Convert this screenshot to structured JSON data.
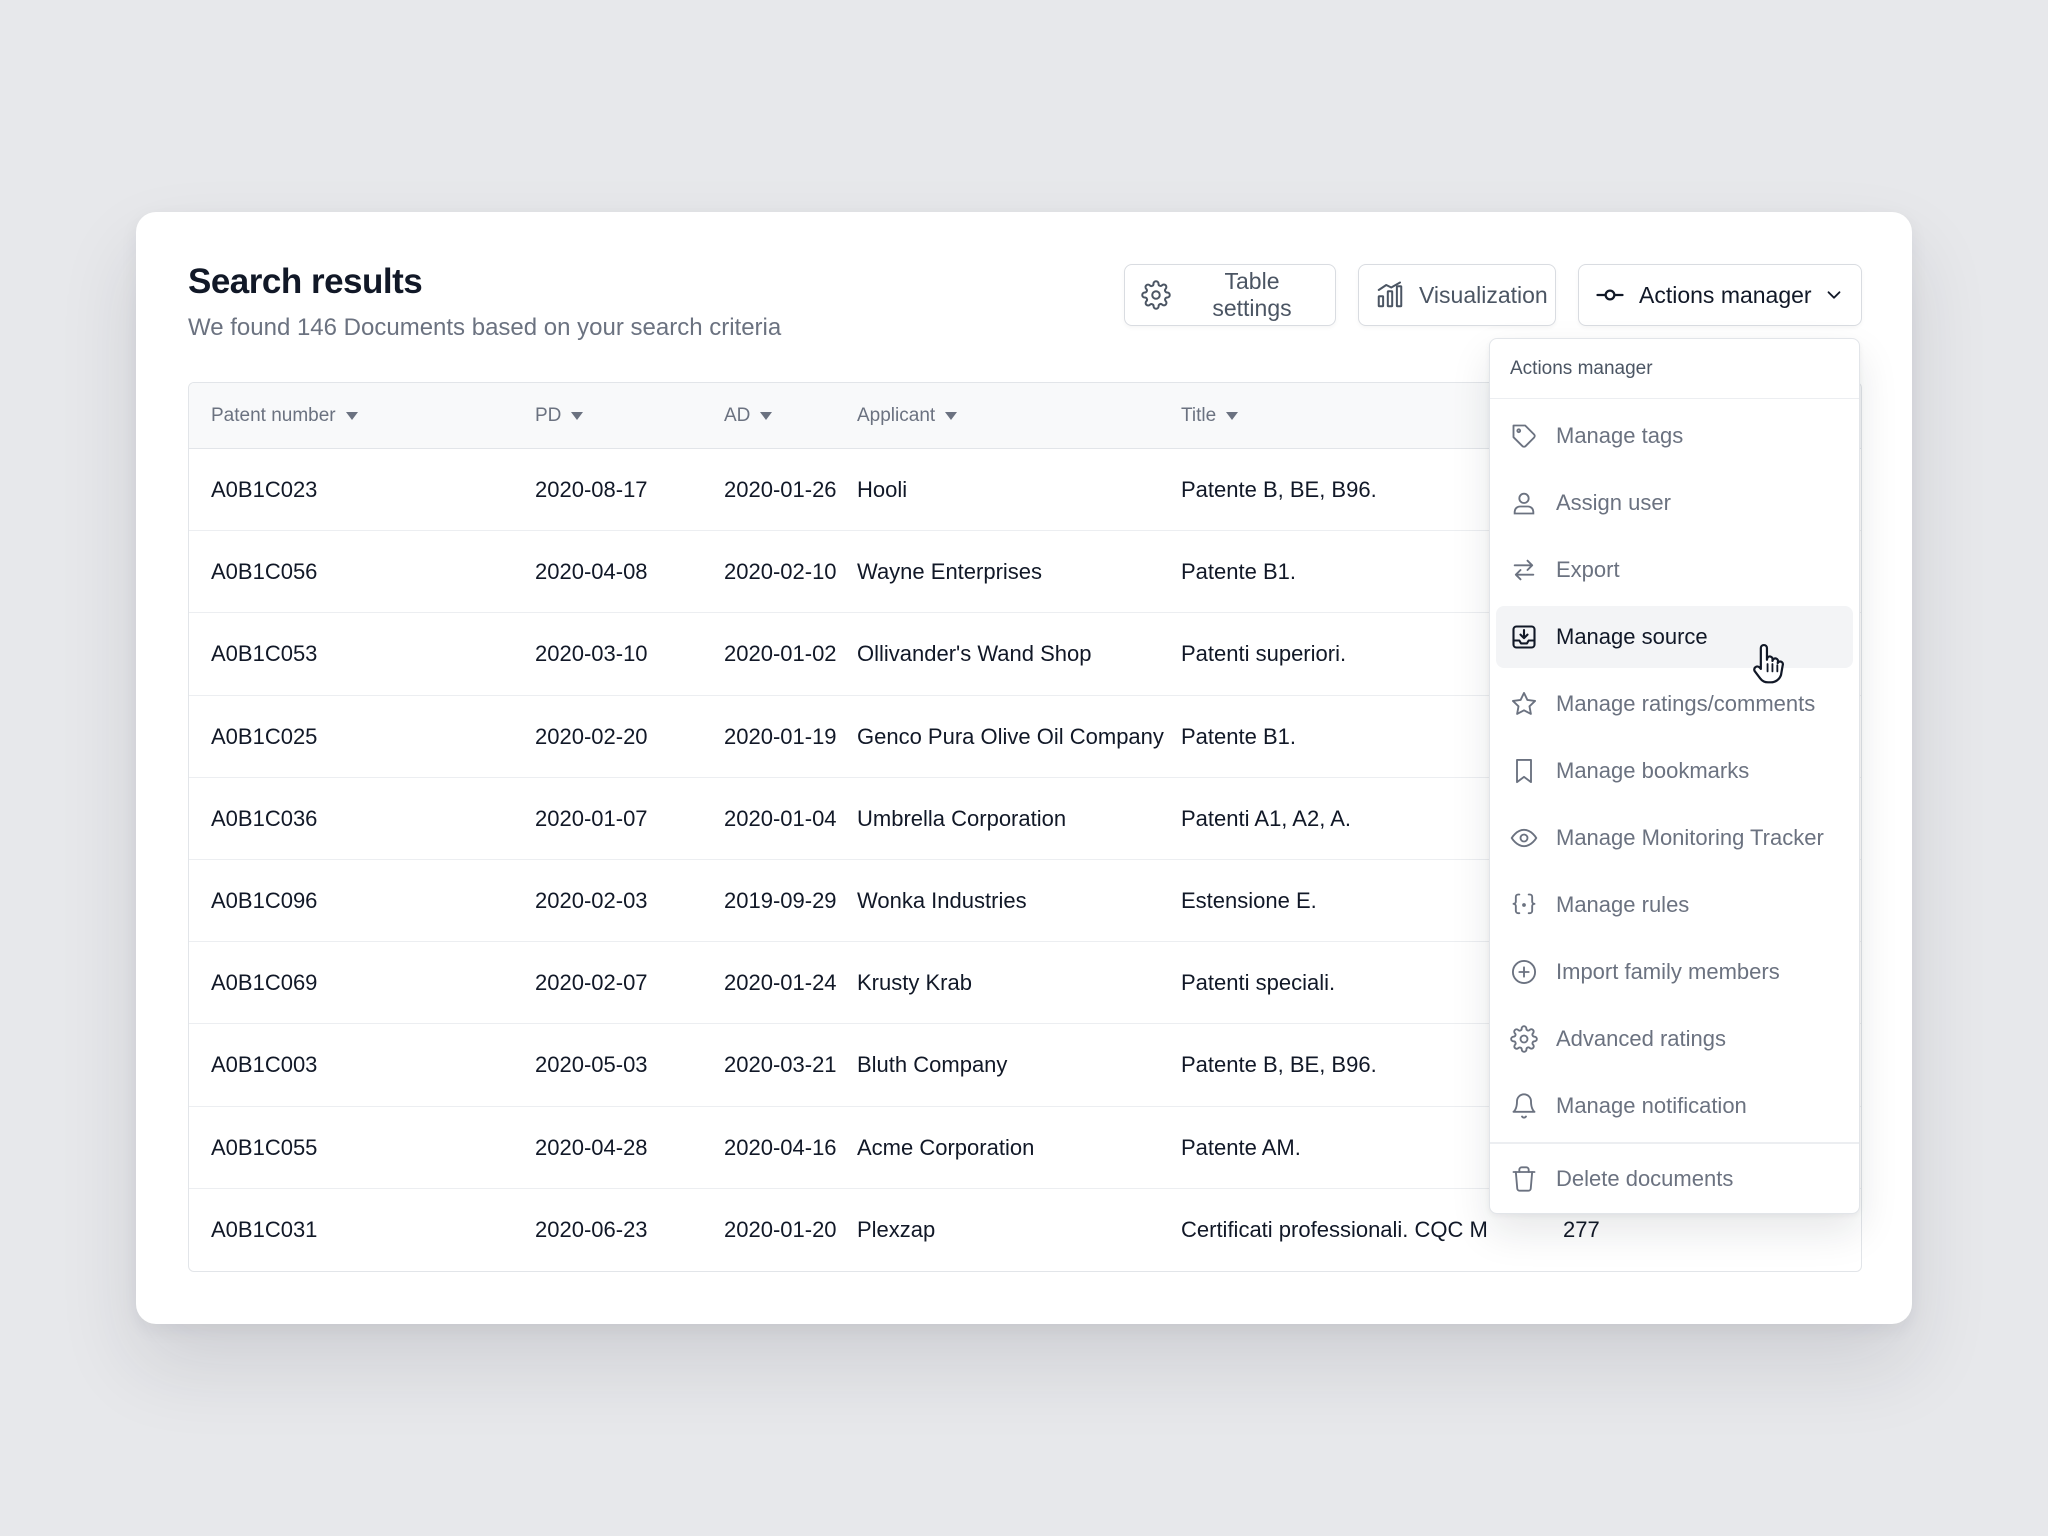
{
  "header": {
    "title": "Search results",
    "subtitle": "We found 146 Documents based on your search criteria"
  },
  "toolbar": {
    "table_settings": "Table settings",
    "visualization": "Visualization",
    "actions_manager": "Actions manager"
  },
  "table": {
    "columns": [
      "Patent number",
      "PD",
      "AD",
      "Applicant",
      "Title"
    ],
    "rows": [
      {
        "patent": "A0B1C023",
        "pd": "2020-08-17",
        "ad": "2020-01-26",
        "applicant": "Hooli",
        "title": "Patente B, BE, B96.",
        "extra": ""
      },
      {
        "patent": "A0B1C056",
        "pd": "2020-04-08",
        "ad": "2020-02-10",
        "applicant": "Wayne Enterprises",
        "title": "Patente B1.",
        "extra": ""
      },
      {
        "patent": "A0B1C053",
        "pd": "2020-03-10",
        "ad": "2020-01-02",
        "applicant": "Ollivander's Wand Shop",
        "title": "Patenti superiori.",
        "extra": ""
      },
      {
        "patent": "A0B1C025",
        "pd": "2020-02-20",
        "ad": "2020-01-19",
        "applicant": "Genco Pura Olive Oil Company",
        "title": "Patente B1.",
        "extra": ""
      },
      {
        "patent": "A0B1C036",
        "pd": "2020-01-07",
        "ad": "2020-01-04",
        "applicant": "Umbrella Corporation",
        "title": "Patenti A1, A2, A.",
        "extra": ""
      },
      {
        "patent": "A0B1C096",
        "pd": "2020-02-03",
        "ad": "2019-09-29",
        "applicant": "Wonka Industries",
        "title": "Estensione E.",
        "extra": ""
      },
      {
        "patent": "A0B1C069",
        "pd": "2020-02-07",
        "ad": "2020-01-24",
        "applicant": "Krusty Krab",
        "title": "Patenti speciali.",
        "extra": ""
      },
      {
        "patent": "A0B1C003",
        "pd": "2020-05-03",
        "ad": "2020-03-21",
        "applicant": "Bluth Company",
        "title": "Patente B, BE, B96.",
        "extra": ""
      },
      {
        "patent": "A0B1C055",
        "pd": "2020-04-28",
        "ad": "2020-04-16",
        "applicant": "Acme Corporation",
        "title": "Patente AM.",
        "extra": ""
      },
      {
        "patent": "A0B1C031",
        "pd": "2020-06-23",
        "ad": "2020-01-20",
        "applicant": "Plexzap",
        "title": "Certificati professionali. CQC M",
        "extra": "277"
      }
    ]
  },
  "menu": {
    "header": "Actions manager",
    "items": [
      {
        "label": "Manage tags",
        "icon": "tag-icon"
      },
      {
        "label": "Assign user",
        "icon": "user-icon"
      },
      {
        "label": "Export",
        "icon": "arrows-exchange-icon"
      },
      {
        "label": "Manage source",
        "icon": "inbox-download-icon"
      },
      {
        "label": "Manage ratings/comments",
        "icon": "star-icon"
      },
      {
        "label": "Manage bookmarks",
        "icon": "bookmark-icon"
      },
      {
        "label": "Manage Monitoring Tracker",
        "icon": "eye-icon"
      },
      {
        "label": "Manage rules",
        "icon": "braces-icon"
      },
      {
        "label": "Import family members",
        "icon": "plus-circle-icon"
      },
      {
        "label": "Advanced ratings",
        "icon": "gear-icon"
      },
      {
        "label": "Manage notification",
        "icon": "bell-icon"
      }
    ],
    "delete": {
      "label": "Delete documents",
      "icon": "trash-icon"
    }
  },
  "colors": {
    "background": "#e7e8eb",
    "card": "#ffffff",
    "text_primary": "#111827",
    "text_muted": "#6b7280",
    "border": "#e2e5e9",
    "active_item": "#f3f4f6"
  }
}
